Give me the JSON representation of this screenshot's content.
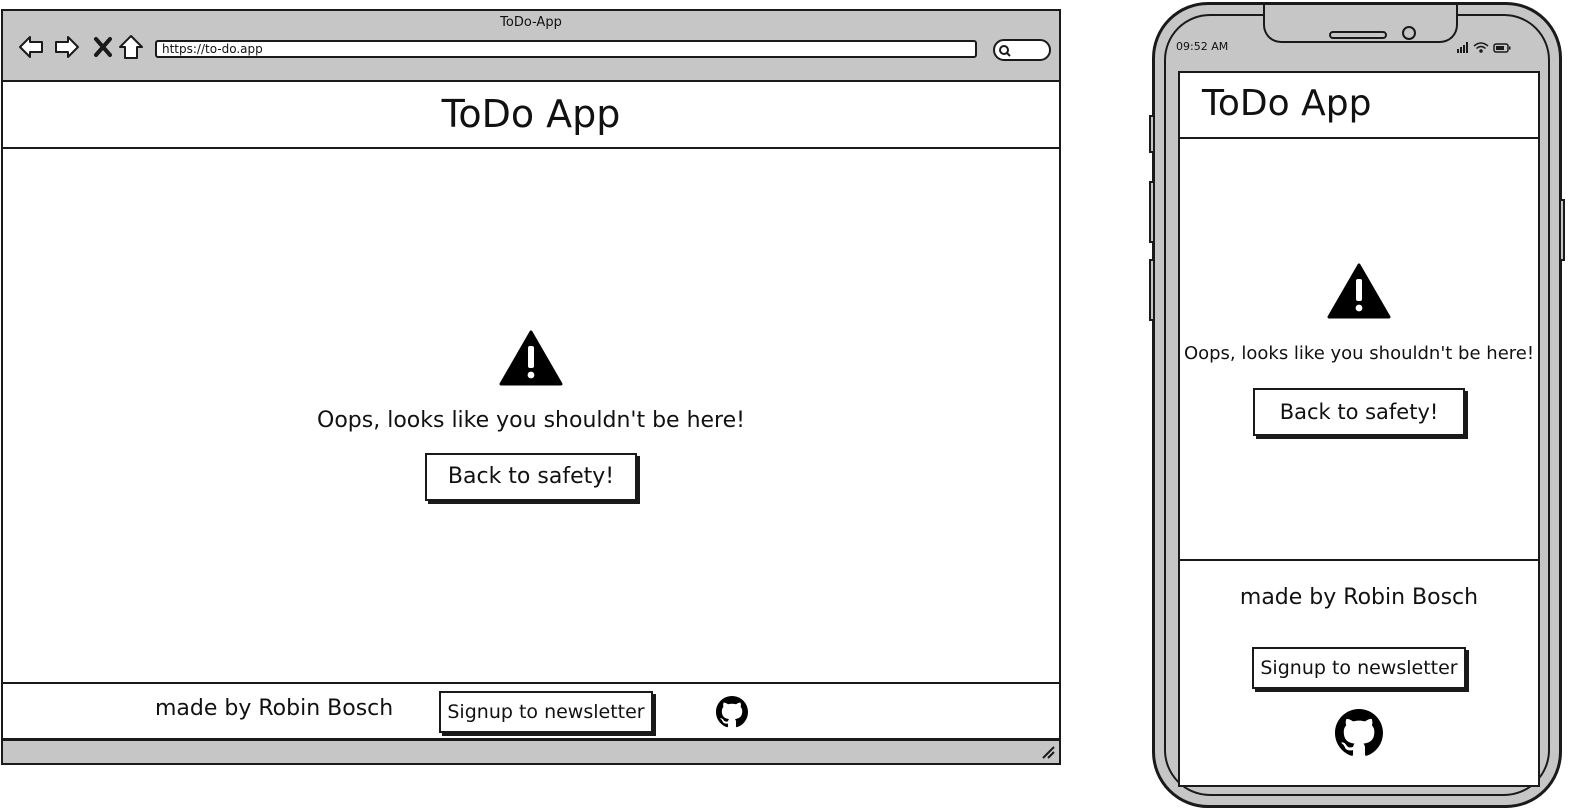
{
  "browser": {
    "window_title": "ToDo-App",
    "url": "https://to-do.app",
    "header": {
      "title": "ToDo App"
    },
    "content": {
      "icon": "warning-triangle-icon",
      "message": "Oops, looks like you shouldn't be here!",
      "back_button": "Back to safety!"
    },
    "footer": {
      "credit": "made by Robin Bosch",
      "newsletter_button": "Signup to newsletter",
      "icon": "github-icon"
    }
  },
  "phone": {
    "status_time": "09:52 AM",
    "header": {
      "title": "ToDo App"
    },
    "content": {
      "icon": "warning-triangle-icon",
      "message": "Oops, looks like you shouldn't be here!",
      "back_button": "Back to safety!"
    },
    "footer": {
      "credit": "made by Robin Bosch",
      "newsletter_button": "Signup to newsletter",
      "icon": "github-icon"
    }
  },
  "colors": {
    "chrome_gray": "#c6c6c6",
    "ink": "#1a1a1a",
    "page": "#ffffff"
  }
}
